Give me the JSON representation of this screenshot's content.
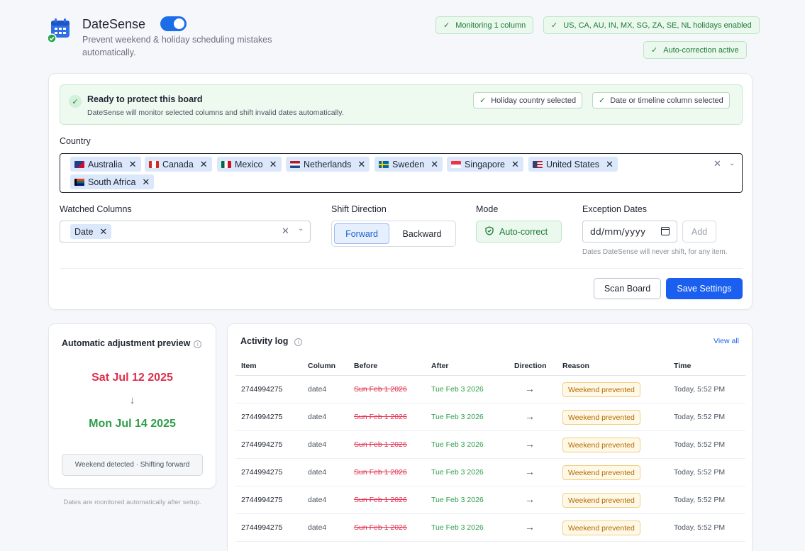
{
  "app": {
    "title": "DateSense",
    "subtitle": "Prevent weekend & holiday scheduling mistakes automatically.",
    "enabled": true
  },
  "header_badges": {
    "monitoring": "Monitoring 1 column",
    "holidays": "US, CA, AU, IN, MX, SG, ZA, SE, NL holidays enabled",
    "autocorrect": "Auto-correction active"
  },
  "ready": {
    "title": "Ready to protect this board",
    "description": "DateSense will monitor selected columns and shift invalid dates automatically.",
    "chips": [
      "Holiday country selected",
      "Date or timeline column selected"
    ]
  },
  "country": {
    "label": "Country",
    "selected": [
      "Australia",
      "Canada",
      "Mexico",
      "Netherlands",
      "Sweden",
      "Singapore",
      "United States",
      "South Africa"
    ]
  },
  "watched_columns": {
    "label": "Watched Columns",
    "selected": [
      "Date"
    ]
  },
  "shift_direction": {
    "label": "Shift Direction",
    "options": [
      "Forward",
      "Backward"
    ],
    "selected": "Forward"
  },
  "mode": {
    "label": "Mode",
    "value": "Auto-correct"
  },
  "exception_dates": {
    "label": "Exception Dates",
    "placeholder": "dd/mm/yyyy",
    "add_label": "Add",
    "hint": "Dates DateSense will never shift, for any item."
  },
  "actions": {
    "scan": "Scan Board",
    "save": "Save Settings"
  },
  "preview": {
    "title": "Automatic adjustment preview",
    "before": "Sat Jul 12 2025",
    "arrow": "↓",
    "after": "Mon Jul 14 2025",
    "status": "Weekend detected · Shifting forward",
    "footnote": "Dates are monitored automatically after setup."
  },
  "activity": {
    "title": "Activity log",
    "view_all": "View all",
    "columns": [
      "Item",
      "Column",
      "Before",
      "After",
      "Direction",
      "Reason",
      "Time"
    ],
    "rows": [
      {
        "item": "2744994275",
        "column": "date4",
        "before": "Sun Feb 1 2026",
        "after": "Tue Feb 3 2026",
        "direction": "→",
        "reason": "Weekend prevented",
        "time": "Today, 5:52 PM"
      },
      {
        "item": "2744994275",
        "column": "date4",
        "before": "Sun Feb 1 2026",
        "after": "Tue Feb 3 2026",
        "direction": "→",
        "reason": "Weekend prevented",
        "time": "Today, 5:52 PM"
      },
      {
        "item": "2744994275",
        "column": "date4",
        "before": "Sun Feb 1 2026",
        "after": "Tue Feb 3 2026",
        "direction": "→",
        "reason": "Weekend prevented",
        "time": "Today, 5:52 PM"
      },
      {
        "item": "2744994275",
        "column": "date4",
        "before": "Sun Feb 1 2026",
        "after": "Tue Feb 3 2026",
        "direction": "→",
        "reason": "Weekend prevented",
        "time": "Today, 5:52 PM"
      },
      {
        "item": "2744994275",
        "column": "date4",
        "before": "Sun Feb 1 2026",
        "after": "Tue Feb 3 2026",
        "direction": "→",
        "reason": "Weekend prevented",
        "time": "Today, 5:52 PM"
      },
      {
        "item": "2744994275",
        "column": "date4",
        "before": "Sun Feb 1 2026",
        "after": "Tue Feb 3 2026",
        "direction": "→",
        "reason": "Weekend prevented",
        "time": "Today, 5:52 PM"
      }
    ]
  },
  "colors": {
    "accent": "#1a5ff0",
    "success": "#2e9e4a",
    "danger": "#e02d4b",
    "warning": "#b26a00"
  }
}
